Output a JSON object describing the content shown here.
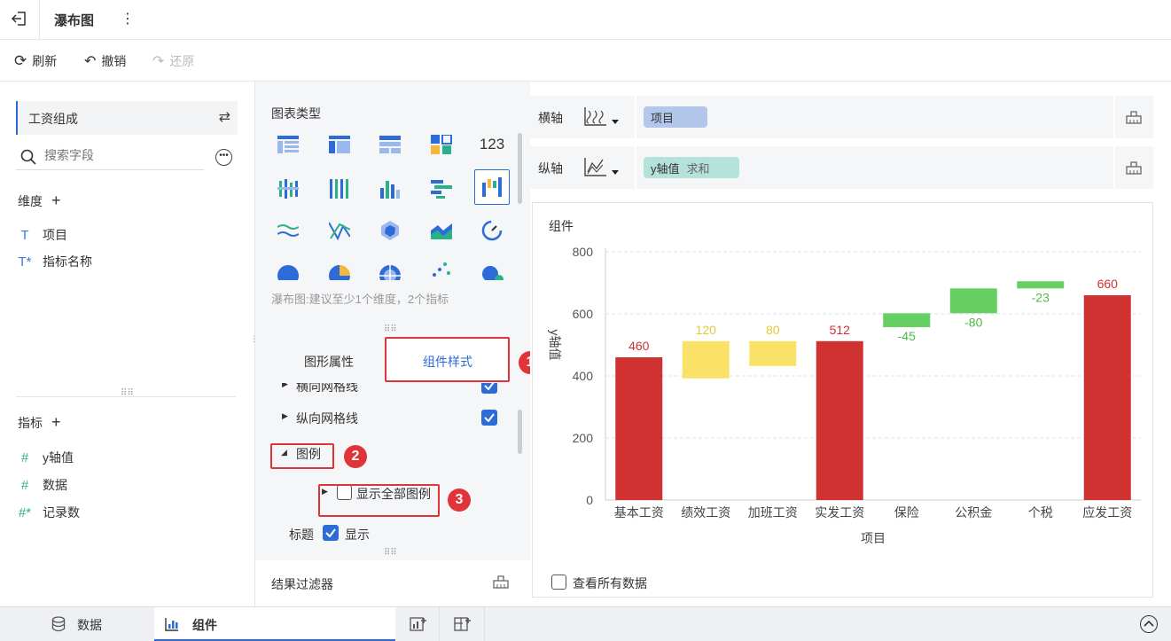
{
  "titlebar": {
    "title": "瀑布图",
    "more": "⋮"
  },
  "toolbar": {
    "refresh": "刷新",
    "undo": "撤销",
    "redo": "还原"
  },
  "left": {
    "dataset": "工资组成",
    "search_placeholder": "搜索字段",
    "dimension_title": "维度",
    "dimensions": [
      {
        "icon": "T",
        "label": "项目"
      },
      {
        "icon": "T*",
        "label": "指标名称"
      }
    ],
    "measure_title": "指标",
    "measures": [
      {
        "icon": "#",
        "label": "y轴值"
      },
      {
        "icon": "#",
        "label": "数据"
      },
      {
        "icon": "#*",
        "label": "记录数"
      }
    ]
  },
  "middle": {
    "chart_type_title": "图表类型",
    "hint": "瀑布图:建议至少1个维度，2个指标",
    "tab_graphic": "图形属性",
    "tab_style": "组件样式",
    "item_hgrid": "横向网格线",
    "item_vgrid": "纵向网格线",
    "item_legend": "图例",
    "item_show_all_legend": "显示全部图例",
    "title_label": "标题",
    "title_show": "显示",
    "result_filter": "结果过滤器"
  },
  "annotations": {
    "a1": "1",
    "a2": "2",
    "a3": "3"
  },
  "right": {
    "x_axis_label": "横轴",
    "y_axis_label": "纵轴",
    "x_field": "项目",
    "y_field": "y轴值",
    "y_agg": "求和",
    "widget_title": "组件",
    "view_all": "查看所有数据"
  },
  "bottom": {
    "tab_data": "数据",
    "tab_widget": "组件"
  },
  "colors": {
    "accent": "#2d6bd6",
    "red": "#d03232",
    "yellow": "#f9e267",
    "green": "#65cf62",
    "annot": "#e0333a"
  },
  "chart_data": {
    "type": "bar",
    "subtype": "waterfall",
    "categories": [
      "基本工资",
      "绩效工资",
      "加班工资",
      "实发工资",
      "保险",
      "公积金",
      "个税",
      "应发工资"
    ],
    "labels": [
      "460",
      "120",
      "80",
      "512",
      "-45",
      "-80",
      "-23",
      "660"
    ],
    "bars": [
      {
        "base": 0,
        "top": 460,
        "kind": "total"
      },
      {
        "base": 392,
        "top": 512,
        "kind": "up"
      },
      {
        "base": 432,
        "top": 512,
        "kind": "up"
      },
      {
        "base": 0,
        "top": 512,
        "kind": "total"
      },
      {
        "base": 557,
        "top": 602,
        "kind": "down"
      },
      {
        "base": 602,
        "top": 682,
        "kind": "down"
      },
      {
        "base": 682,
        "top": 705,
        "kind": "down"
      },
      {
        "base": 0,
        "top": 660,
        "kind": "total"
      }
    ],
    "yticks": [
      0,
      200,
      400,
      600,
      800
    ],
    "ylim": [
      0,
      800
    ],
    "xlabel": "项目",
    "ylabel": "y轴值",
    "grid": true
  }
}
